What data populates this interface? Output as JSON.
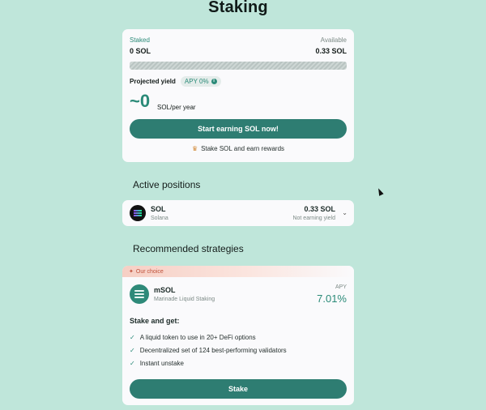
{
  "page_title": "Staking",
  "stake_card": {
    "staked_label": "Staked",
    "staked_value": "0 SOL",
    "available_label": "Available",
    "available_value": "0.33 SOL",
    "progress_fraction": 0,
    "projected_yield_label": "Projected yield",
    "apy_pill": "APY 0%",
    "big_amount": "~0",
    "big_unit": "SOL/per year",
    "cta_label": "Start earning SOL now!",
    "footnote": "Stake SOL and earn rewards"
  },
  "active_positions": {
    "title": "Active positions",
    "items": [
      {
        "name": "SOL",
        "subtitle": "Solana",
        "amount": "0.33 SOL",
        "status": "Not earning yield"
      }
    ]
  },
  "recommended": {
    "title": "Recommended strategies",
    "strategy": {
      "badge": "Our choice",
      "name": "mSOL",
      "subtitle": "Marinade Liquid Staking",
      "apy_label": "APY",
      "apy_value": "7.01%",
      "list_title": "Stake and get:",
      "benefits": [
        "A liquid token to use in 20+ DeFi options",
        "Decentralized set of 124 best-performing validators",
        "Instant unstake"
      ],
      "button_label": "Stake"
    }
  },
  "colors": {
    "accent": "#2e7d72",
    "background": "#bfe6da",
    "card": "#fafafc"
  },
  "icons": [
    "info-icon",
    "trophy-icon",
    "solana-logo-icon",
    "chevron-down-icon",
    "sparkle-icon",
    "msol-logo-icon",
    "check-icon"
  ]
}
